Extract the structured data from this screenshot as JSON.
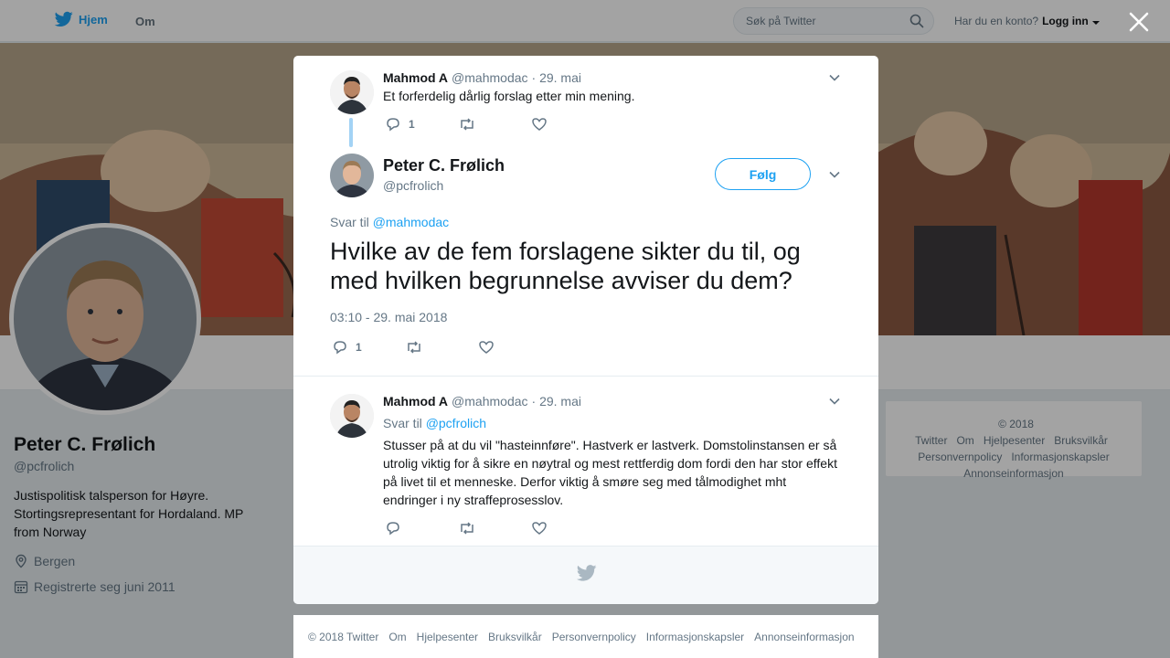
{
  "topbar": {
    "home_label": "Hjem",
    "about_label": "Om",
    "search_placeholder": "Søk på Twitter",
    "account_question": "Har du en konto?",
    "login_label": "Logg inn"
  },
  "profile": {
    "name": "Peter C. Frølich",
    "handle": "@pcfrolich",
    "bio": "Justispolitisk talsperson for Høyre. Stortingsrepresentant for Hordaland. MP from Norway",
    "location": "Bergen",
    "joined": "Registrerte seg juni 2011"
  },
  "side_footer": {
    "links": [
      "© 2018 Twitter",
      "Om",
      "Hjelpesenter",
      "Bruksvilkår",
      "Personvernpolicy",
      "Informasjonskapsler",
      "Annonseinformasjon"
    ]
  },
  "modal": {
    "parent_tweet": {
      "name": "Mahmod A",
      "handle": "@mahmodac",
      "date": "· 29. mai",
      "text": "Et forferdelig dårlig forslag etter min mening.",
      "reply_count": "1"
    },
    "main_tweet": {
      "name": "Peter C. Frølich",
      "handle": "@pcfrolich",
      "follow_label": "Følg",
      "reply_prefix": "Svar til",
      "reply_to": "@mahmodac",
      "text": "Hvilke av de fem forslagene sikter du til, og med hvilken begrunnelse avviser du dem?",
      "timestamp": "03:10 - 29. mai 2018",
      "reply_count": "1"
    },
    "reply_tweet": {
      "name": "Mahmod A",
      "handle": "@mahmodac",
      "date": "· 29. mai",
      "reply_prefix": "Svar til",
      "reply_to": "@pcfrolich",
      "text": "Stusser på at du vil \"hasteinnføre\". Hastverk er lastverk. Domstolinstansen er så utrolig viktig for å sikre en nøytral og mest rettferdig dom fordi den har stor effekt på livet til et menneske. Derfor viktig å smøre seg med tålmodighet mht endringer i ny straffeprosesslov."
    }
  },
  "bottom_footer": {
    "links": [
      "© 2018 Twitter",
      "Om",
      "Hjelpesenter",
      "Bruksvilkår",
      "Personvernpolicy",
      "Informasjonskapsler",
      "Annonseinformasjon"
    ]
  },
  "colors": {
    "accent": "#1da1f2",
    "text": "#14171a",
    "muted": "#657786",
    "thread_line": "#a3d3f5"
  },
  "icons": [
    "twitter-bird-icon",
    "search-icon",
    "close-icon",
    "chevron-down-icon",
    "reply-icon",
    "retweet-icon",
    "like-icon",
    "location-icon",
    "calendar-icon"
  ]
}
